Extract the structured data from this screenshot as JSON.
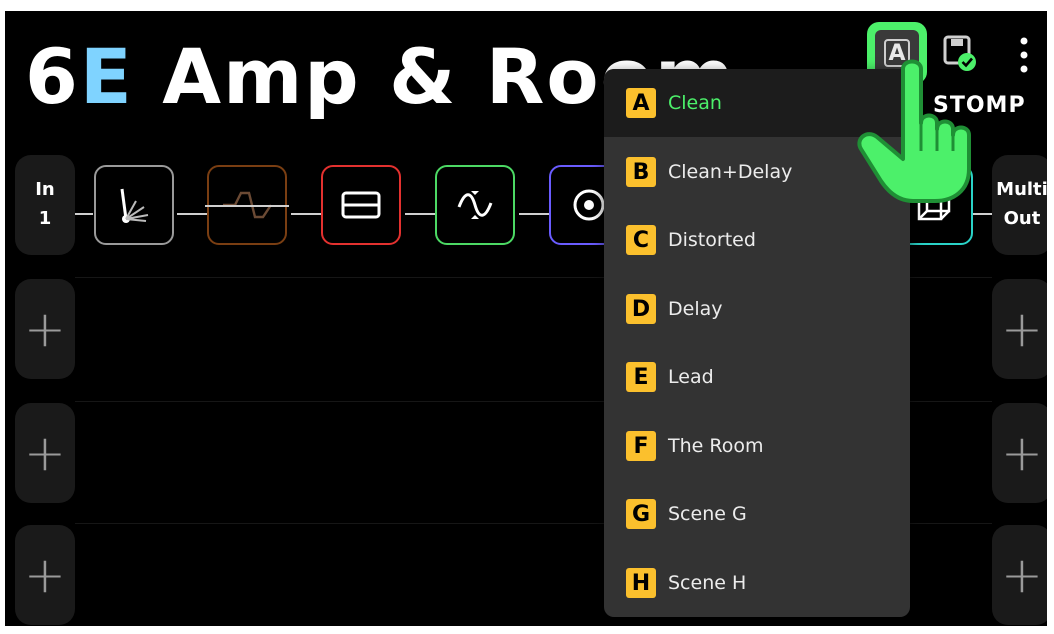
{
  "preset": {
    "title_prefix": "6",
    "title_accent": "E",
    "title_rest": " Amp & Room"
  },
  "header": {
    "view_label": "STOMP",
    "current_scene_letter": "A"
  },
  "signal_chain": {
    "input": {
      "line1": "In",
      "line2": "1"
    },
    "output": {
      "line1": "Multi",
      "line2": "Out"
    },
    "blocks": [
      {
        "icon": "dynamics-icon",
        "color": "#9a9a9a"
      },
      {
        "icon": "eq-icon",
        "color": "#7a3e12",
        "bypassed": true
      },
      {
        "icon": "amp-icon",
        "color": "#e3312f"
      },
      {
        "icon": "modulation-icon",
        "color": "#4cd964"
      },
      {
        "icon": "speaker-icon",
        "color": "#6a5cff"
      },
      {
        "icon": "room-icon",
        "color": "#2ad3c8"
      }
    ],
    "add_symbol": "+"
  },
  "scene_menu": {
    "selected": "A",
    "items": [
      {
        "letter": "A",
        "label": "Clean"
      },
      {
        "letter": "B",
        "label": "Clean+Delay"
      },
      {
        "letter": "C",
        "label": "Distorted"
      },
      {
        "letter": "D",
        "label": "Delay"
      },
      {
        "letter": "E",
        "label": "Lead"
      },
      {
        "letter": "F",
        "label": "The Room"
      },
      {
        "letter": "G",
        "label": "Scene G"
      },
      {
        "letter": "H",
        "label": "Scene H"
      }
    ]
  },
  "colors": {
    "accent_green": "#4cf06a",
    "title_accent": "#7fd3ff",
    "scene_badge": "#fbc02d",
    "menu_bg": "#333333",
    "background": "#000000"
  }
}
